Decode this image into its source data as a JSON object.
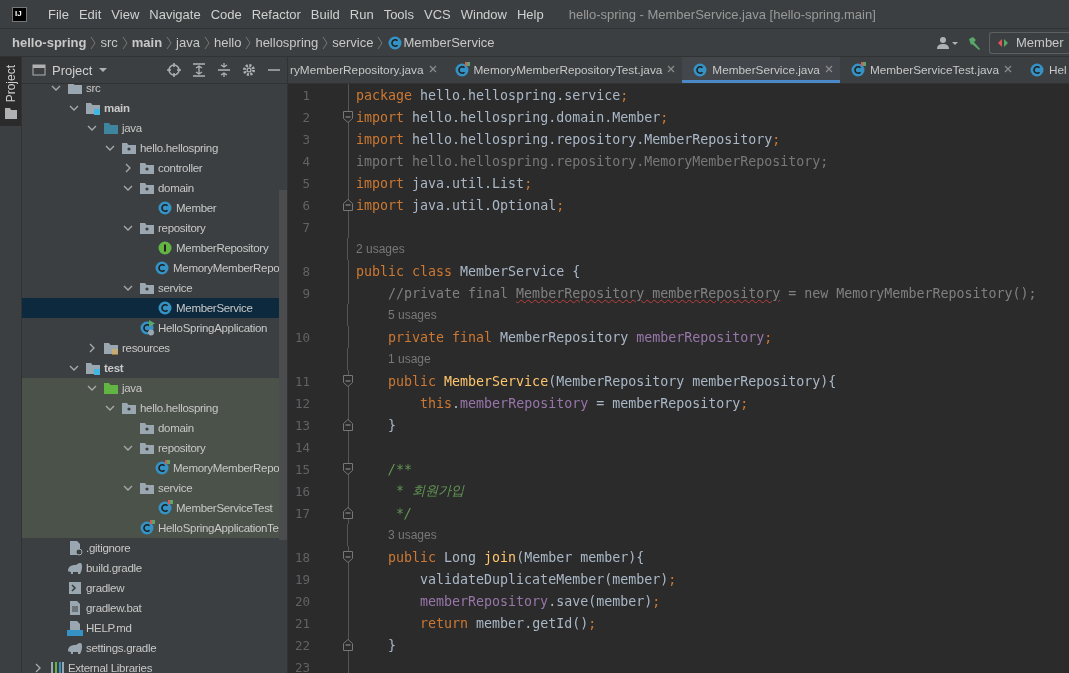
{
  "window": {
    "logo": "IJ",
    "title": "hello-spring - MemberService.java [hello-spring.main]"
  },
  "menu": [
    "File",
    "Edit",
    "View",
    "Navigate",
    "Code",
    "Refactor",
    "Build",
    "Run",
    "Tools",
    "VCS",
    "Window",
    "Help"
  ],
  "breadcrumbs": [
    {
      "label": "hello-spring",
      "bold": true
    },
    {
      "label": "src",
      "bold": false
    },
    {
      "label": "main",
      "bold": true
    },
    {
      "label": "java",
      "bold": false
    },
    {
      "label": "hello",
      "bold": false
    },
    {
      "label": "hellospring",
      "bold": false
    },
    {
      "label": "service",
      "bold": false
    },
    {
      "label": "MemberService",
      "bold": false,
      "kind": "class"
    }
  ],
  "run_config": {
    "label": "Member"
  },
  "tool_stripe": {
    "label": "Project",
    "selected": true
  },
  "project_panel": {
    "title": "Project"
  },
  "tree": {
    "items": [
      {
        "label": "src",
        "kind": "folder",
        "bold": false,
        "selected": false,
        "tinted": false,
        "expanded": true,
        "children": [
          {
            "label": "main",
            "kind": "source-root",
            "bold": true,
            "selected": false,
            "tinted": false,
            "expanded": true,
            "children": [
              {
                "label": "java",
                "kind": "java-root",
                "bold": false,
                "selected": false,
                "tinted": false,
                "expanded": true,
                "children": [
                  {
                    "label": "hello.hellospring",
                    "kind": "package",
                    "bold": false,
                    "selected": false,
                    "tinted": false,
                    "expanded": true,
                    "children": [
                      {
                        "label": "controller",
                        "kind": "package",
                        "bold": false,
                        "selected": false,
                        "tinted": false,
                        "expanded": false
                      },
                      {
                        "label": "domain",
                        "kind": "package",
                        "bold": false,
                        "selected": false,
                        "tinted": false,
                        "expanded": true,
                        "children": [
                          {
                            "label": "Member",
                            "kind": "class",
                            "bold": false,
                            "selected": false,
                            "tinted": false
                          }
                        ]
                      },
                      {
                        "label": "repository",
                        "kind": "package",
                        "bold": false,
                        "selected": false,
                        "tinted": false,
                        "expanded": true,
                        "children": [
                          {
                            "label": "MemberRepository",
                            "kind": "interface",
                            "bold": false,
                            "selected": false,
                            "tinted": false
                          },
                          {
                            "label": "MemoryMemberRepo",
                            "kind": "class",
                            "bold": false,
                            "selected": false,
                            "tinted": false
                          }
                        ]
                      },
                      {
                        "label": "service",
                        "kind": "package",
                        "bold": false,
                        "selected": false,
                        "tinted": false,
                        "expanded": true,
                        "children": [
                          {
                            "label": "MemberService",
                            "kind": "class",
                            "bold": false,
                            "selected": true,
                            "tinted": false
                          }
                        ]
                      },
                      {
                        "label": "HelloSpringApplication",
                        "kind": "spring-class",
                        "bold": false,
                        "selected": false,
                        "tinted": false
                      }
                    ]
                  }
                ]
              },
              {
                "label": "resources",
                "kind": "resources-root",
                "bold": false,
                "selected": false,
                "tinted": false,
                "expanded": false
              }
            ]
          },
          {
            "label": "test",
            "kind": "source-root",
            "bold": true,
            "selected": false,
            "tinted": false,
            "expanded": true,
            "children": [
              {
                "label": "java",
                "kind": "test-root",
                "bold": false,
                "selected": false,
                "tinted": true,
                "expanded": true,
                "children": [
                  {
                    "label": "hello.hellospring",
                    "kind": "package",
                    "bold": false,
                    "selected": false,
                    "tinted": true,
                    "expanded": true,
                    "children": [
                      {
                        "label": "domain",
                        "kind": "package",
                        "bold": false,
                        "selected": false,
                        "tinted": true
                      },
                      {
                        "label": "repository",
                        "kind": "package",
                        "bold": false,
                        "selected": false,
                        "tinted": true,
                        "expanded": true,
                        "children": [
                          {
                            "label": "MemoryMemberRepo",
                            "kind": "test-class",
                            "bold": false,
                            "selected": false,
                            "tinted": true
                          }
                        ]
                      },
                      {
                        "label": "service",
                        "kind": "package",
                        "bold": false,
                        "selected": false,
                        "tinted": true,
                        "expanded": true,
                        "children": [
                          {
                            "label": "MemberServiceTest",
                            "kind": "test-class",
                            "bold": false,
                            "selected": false,
                            "tinted": true
                          }
                        ]
                      },
                      {
                        "label": "HelloSpringApplicationTe",
                        "kind": "test-class",
                        "bold": false,
                        "selected": false,
                        "tinted": true
                      }
                    ]
                  }
                ]
              }
            ]
          }
        ]
      },
      {
        "label": ".gitignore",
        "kind": "ignore-file",
        "bold": false,
        "selected": false,
        "tinted": false
      },
      {
        "label": "build.gradle",
        "kind": "gradle",
        "bold": false,
        "selected": false,
        "tinted": false
      },
      {
        "label": "gradlew",
        "kind": "shell",
        "bold": false,
        "selected": false,
        "tinted": false
      },
      {
        "label": "gradlew.bat",
        "kind": "text-file",
        "bold": false,
        "selected": false,
        "tinted": false
      },
      {
        "label": "HELP.md",
        "kind": "markdown",
        "bold": false,
        "selected": false,
        "tinted": false
      },
      {
        "label": "settings.gradle",
        "kind": "gradle",
        "bold": false,
        "selected": false,
        "tinted": false
      }
    ],
    "root_items": [
      {
        "label": "External Libraries",
        "kind": "library",
        "bold": false,
        "selected": false,
        "tinted": false,
        "expanded": false
      }
    ]
  },
  "tabs": [
    {
      "label": "ryMemberRepository.java",
      "selected": false,
      "closable": true
    },
    {
      "label": "MemoryMemberRepositoryTest.java",
      "kind": "test-class",
      "selected": false,
      "closable": true
    },
    {
      "label": "MemberService.java",
      "kind": "class",
      "selected": true,
      "closable": true
    },
    {
      "label": "MemberServiceTest.java",
      "kind": "test-class",
      "selected": false,
      "closable": true
    },
    {
      "label": "Hel",
      "kind": "class",
      "selected": false,
      "closable": false
    }
  ],
  "code": [
    {
      "kind": "code",
      "number": "1",
      "tokens": [
        {
          "text": "package ",
          "kind": "keyword"
        },
        {
          "text": "hello.hellospring.service",
          "kind": "plain"
        },
        {
          "text": ";",
          "kind": "keyword"
        }
      ]
    },
    {
      "kind": "code",
      "number": "2",
      "fold_start": true,
      "tokens": [
        {
          "text": "import ",
          "kind": "keyword"
        },
        {
          "text": "hello.hellospring.domain.Member",
          "kind": "plain"
        },
        {
          "text": ";",
          "kind": "keyword"
        }
      ]
    },
    {
      "kind": "code",
      "number": "3",
      "tokens": [
        {
          "text": "import ",
          "kind": "keyword"
        },
        {
          "text": "hello.hellospring.repository.MemberRepository",
          "kind": "plain"
        },
        {
          "text": ";",
          "kind": "keyword"
        }
      ]
    },
    {
      "kind": "code",
      "number": "4",
      "tokens": [
        {
          "text": "import hello.hellospring.repository.MemoryMemberRepository;",
          "kind": "unused"
        }
      ]
    },
    {
      "kind": "code",
      "number": "5",
      "tokens": [
        {
          "text": "import ",
          "kind": "keyword"
        },
        {
          "text": "java.util.List",
          "kind": "plain"
        },
        {
          "text": ";",
          "kind": "keyword"
        }
      ]
    },
    {
      "kind": "code",
      "number": "6",
      "fold_end": true,
      "tokens": [
        {
          "text": "import ",
          "kind": "keyword"
        },
        {
          "text": "java.util.Optional",
          "kind": "plain"
        },
        {
          "text": ";",
          "kind": "keyword"
        }
      ]
    },
    {
      "kind": "code",
      "number": "7"
    },
    {
      "kind": "hint",
      "text": "2 usages",
      "indented": false
    },
    {
      "kind": "code",
      "number": "8",
      "tokens": [
        {
          "text": "public class ",
          "kind": "keyword"
        },
        {
          "text": "MemberService {",
          "kind": "plain"
        }
      ]
    },
    {
      "kind": "code",
      "number": "9",
      "tokens": [
        {
          "text": "    //private final ",
          "kind": "comment"
        },
        {
          "text": "MemberRepository memberRepository",
          "kind": "comment",
          "squiggly": true
        },
        {
          "text": " = new MemoryMemberRepository();",
          "kind": "comment"
        }
      ]
    },
    {
      "kind": "hint",
      "text": "5 usages",
      "indented": true
    },
    {
      "kind": "code",
      "number": "10",
      "tokens": [
        {
          "text": "    private final ",
          "kind": "keyword"
        },
        {
          "text": "MemberRepository ",
          "kind": "plain"
        },
        {
          "text": "memberRepository",
          "kind": "field"
        },
        {
          "text": ";",
          "kind": "keyword"
        }
      ]
    },
    {
      "kind": "hint",
      "text": "1 usage",
      "indented": true
    },
    {
      "kind": "code",
      "number": "11",
      "fold_start": true,
      "tokens": [
        {
          "text": "    public ",
          "kind": "keyword"
        },
        {
          "text": "MemberService",
          "kind": "method"
        },
        {
          "text": "(MemberRepository memberRepository){",
          "kind": "plain"
        }
      ]
    },
    {
      "kind": "code",
      "number": "12",
      "tokens": [
        {
          "text": "        this",
          "kind": "keyword"
        },
        {
          "text": ".",
          "kind": "plain"
        },
        {
          "text": "memberRepository",
          "kind": "field"
        },
        {
          "text": " = memberRepository",
          "kind": "plain"
        },
        {
          "text": ";",
          "kind": "keyword"
        }
      ]
    },
    {
      "kind": "code",
      "number": "13",
      "fold_end": true,
      "tokens": [
        {
          "text": "    }",
          "kind": "plain"
        }
      ]
    },
    {
      "kind": "code",
      "number": "14"
    },
    {
      "kind": "code",
      "number": "15",
      "fold_start": true,
      "tokens": [
        {
          "text": "    /**",
          "kind": "doc"
        }
      ]
    },
    {
      "kind": "code",
      "number": "16",
      "tokens": [
        {
          "text": "     * 회원가입",
          "kind": "doc"
        }
      ]
    },
    {
      "kind": "code",
      "number": "17",
      "fold_end": true,
      "tokens": [
        {
          "text": "     */",
          "kind": "doc"
        }
      ]
    },
    {
      "kind": "hint",
      "text": "3 usages",
      "indented": true
    },
    {
      "kind": "code",
      "number": "18",
      "fold_start": true,
      "tokens": [
        {
          "text": "    public ",
          "kind": "keyword"
        },
        {
          "text": "Long ",
          "kind": "plain"
        },
        {
          "text": "join",
          "kind": "method"
        },
        {
          "text": "(Member member){",
          "kind": "plain"
        }
      ]
    },
    {
      "kind": "code",
      "number": "19",
      "tokens": [
        {
          "text": "        validateDuplicateMember(member)",
          "kind": "plain"
        },
        {
          "text": ";",
          "kind": "keyword"
        }
      ]
    },
    {
      "kind": "code",
      "number": "20",
      "tokens": [
        {
          "text": "        memberRepository",
          "kind": "field"
        },
        {
          "text": ".save(member)",
          "kind": "plain"
        },
        {
          "text": ";",
          "kind": "keyword"
        }
      ]
    },
    {
      "kind": "code",
      "number": "21",
      "tokens": [
        {
          "text": "        return ",
          "kind": "keyword"
        },
        {
          "text": "member.getId()",
          "kind": "plain"
        },
        {
          "text": ";",
          "kind": "keyword"
        }
      ]
    },
    {
      "kind": "code",
      "number": "22",
      "fold_end": true,
      "tokens": [
        {
          "text": "    }",
          "kind": "plain"
        }
      ]
    },
    {
      "kind": "code",
      "number": "23"
    }
  ]
}
